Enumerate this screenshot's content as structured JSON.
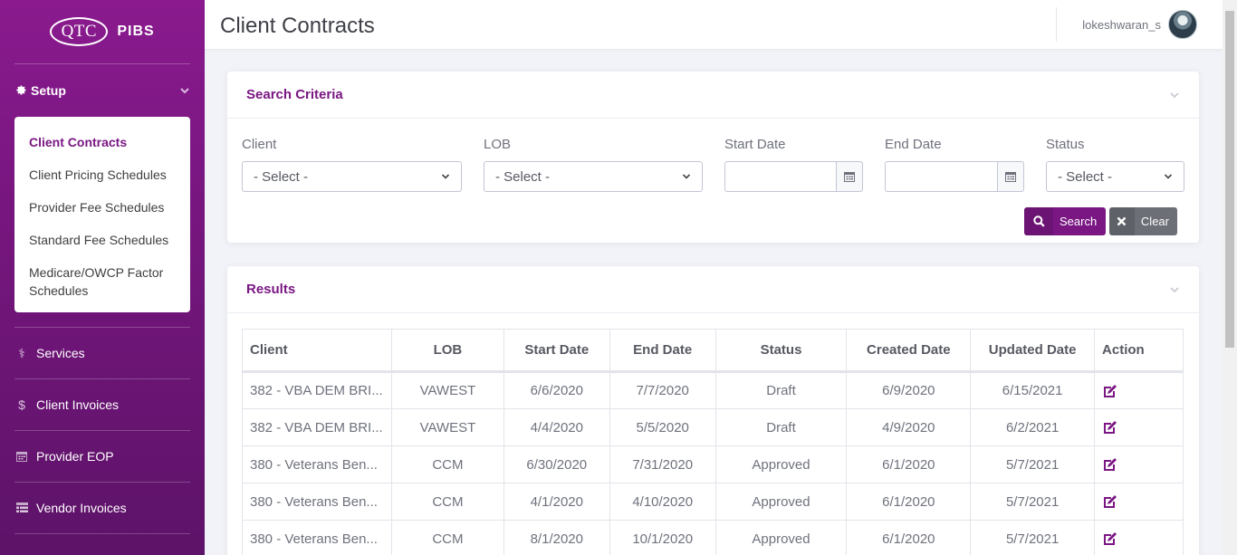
{
  "brand": {
    "logo": "QTC",
    "name": "PIBS"
  },
  "sidebar": {
    "setup_label": "Setup",
    "submenu": [
      {
        "label": "Client Contracts",
        "active": true
      },
      {
        "label": "Client Pricing Schedules"
      },
      {
        "label": "Provider Fee Schedules"
      },
      {
        "label": "Standard Fee Schedules"
      },
      {
        "label": "Medicare/OWCP Factor Schedules"
      }
    ],
    "nav": [
      {
        "label": "Services",
        "icon": "stethoscope-icon"
      },
      {
        "label": "Client Invoices",
        "icon": "dollar-icon"
      },
      {
        "label": "Provider EOP",
        "icon": "calendar-icon"
      },
      {
        "label": "Vendor Invoices",
        "icon": "table-icon"
      }
    ]
  },
  "header": {
    "title": "Client Contracts",
    "username": "lokeshwaran_s"
  },
  "search": {
    "title": "Search Criteria",
    "client_label": "Client",
    "client_value": "- Select -",
    "lob_label": "LOB",
    "lob_value": "- Select -",
    "start_date_label": "Start Date",
    "end_date_label": "End Date",
    "status_label": "Status",
    "status_value": "- Select -",
    "search_button": "Search",
    "clear_button": "Clear"
  },
  "results": {
    "title": "Results",
    "columns": [
      "Client",
      "LOB",
      "Start Date",
      "End Date",
      "Status",
      "Created Date",
      "Updated Date",
      "Action"
    ],
    "rows": [
      [
        "382 - VBA DEM BRI...",
        "VAWEST",
        "6/6/2020",
        "7/7/2020",
        "Draft",
        "6/9/2020",
        "6/15/2021"
      ],
      [
        "382 - VBA DEM BRI...",
        "VAWEST",
        "4/4/2020",
        "5/5/2020",
        "Draft",
        "4/9/2020",
        "6/2/2021"
      ],
      [
        "380 - Veterans Ben...",
        "CCM",
        "6/30/2020",
        "7/31/2020",
        "Approved",
        "6/1/2020",
        "5/7/2021"
      ],
      [
        "380 - Veterans Ben...",
        "CCM",
        "4/1/2020",
        "4/10/2020",
        "Approved",
        "6/1/2020",
        "5/7/2021"
      ],
      [
        "380 - Veterans Ben...",
        "CCM",
        "8/1/2020",
        "10/1/2020",
        "Approved",
        "6/1/2020",
        "5/7/2021"
      ]
    ]
  },
  "colors": {
    "brand": "#7a1783",
    "sidebar_top": "#8a1a8e",
    "sidebar_bottom": "#5d1368",
    "clear_button": "#6d6f77"
  }
}
